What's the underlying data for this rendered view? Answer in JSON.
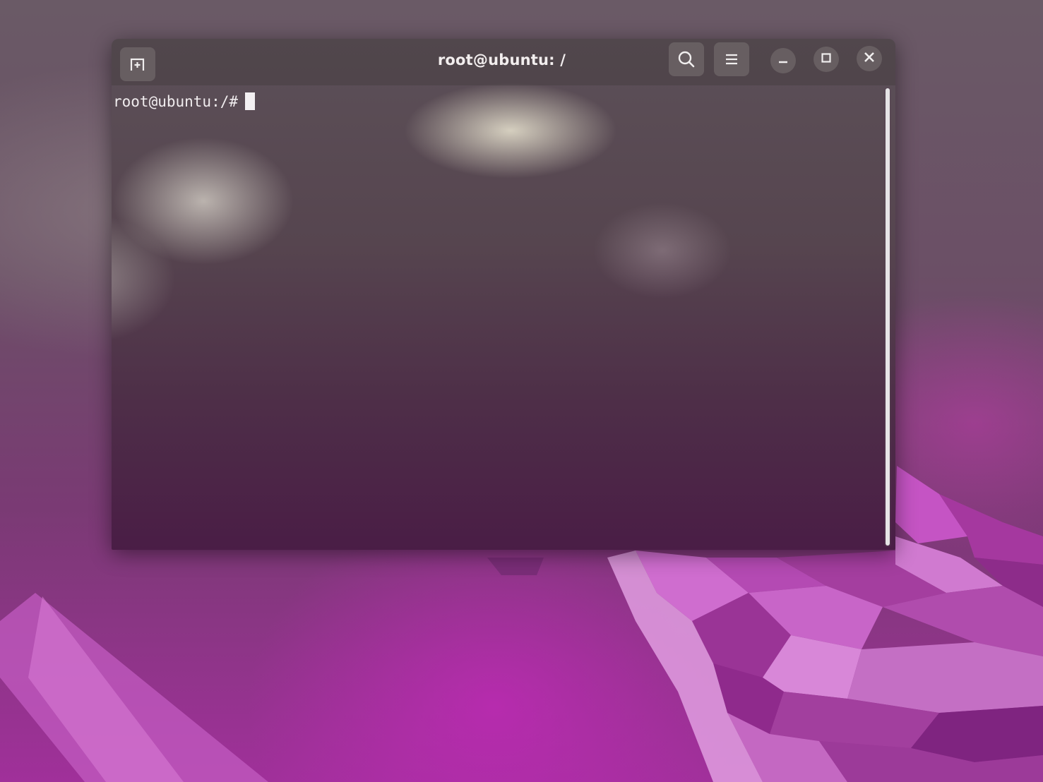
{
  "desktop": {
    "accent": "#b53fb0"
  },
  "terminal": {
    "title": "root@ubuntu: /",
    "prompt": "root@ubuntu:/#",
    "icons": {
      "new_tab": "new-tab-icon",
      "search": "search-icon",
      "menu": "hamburger-menu-icon",
      "minimize": "minimize-icon",
      "maximize": "maximize-icon",
      "close": "close-icon"
    },
    "colors": {
      "text": "#f0ecee",
      "cursor": "#f3f0f2",
      "background": "#4e2f48"
    }
  }
}
